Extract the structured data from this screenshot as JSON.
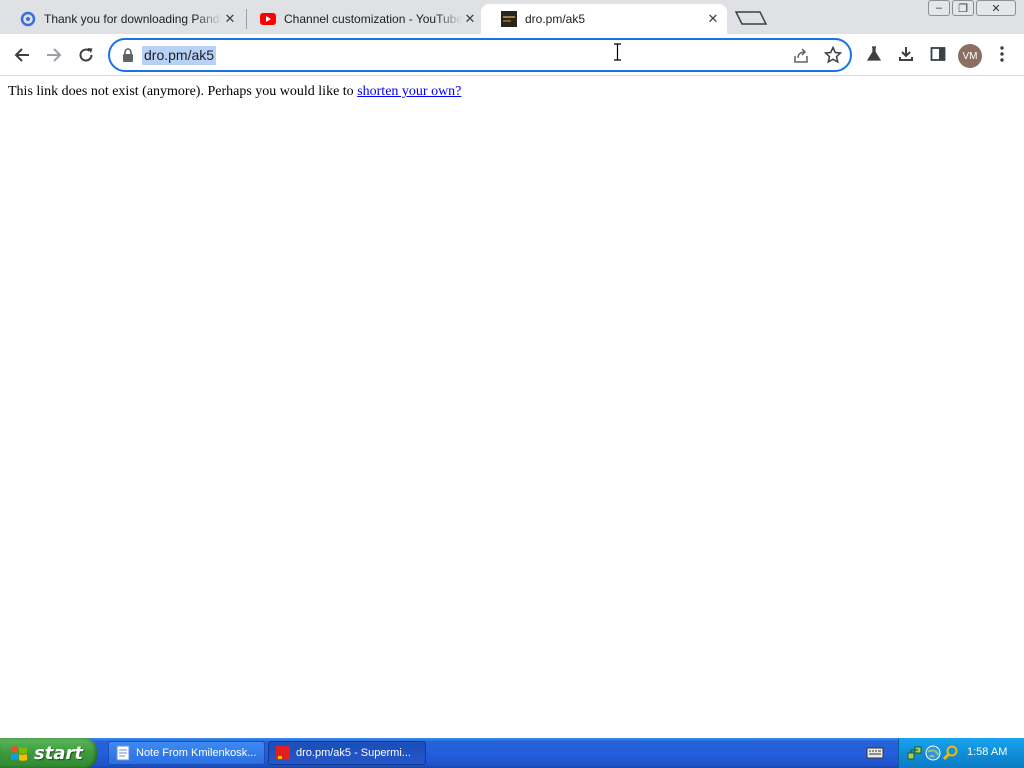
{
  "browser": {
    "tabs": [
      {
        "title": "Thank you for downloading Panda Security",
        "favicon": "panda-favicon",
        "active": false
      },
      {
        "title": "Channel customization - YouTube Studio",
        "favicon": "youtube-favicon",
        "active": false
      },
      {
        "title": "dro.pm/ak5",
        "favicon": "site-favicon",
        "active": true
      }
    ],
    "window_controls": {
      "minimize": "–",
      "restore": "❐",
      "close": "✕"
    },
    "toolbar": {
      "url": "dro.pm/ak5",
      "icons": [
        "back-icon",
        "forward-icon",
        "reload-icon",
        "lock-icon",
        "share-icon",
        "bookmark-star-icon",
        "labs-flask-icon",
        "download-icon",
        "side-panel-icon",
        "menu-kebab-icon"
      ],
      "profile_initials": "VM"
    }
  },
  "page": {
    "message_prefix": "This link does not exist (anymore). Perhaps you would like to ",
    "link_text": "shorten your own?"
  },
  "taskbar": {
    "start_label": "start",
    "items": [
      {
        "label": "Note From Kmilenkosk...",
        "icon": "notepad-icon",
        "pressed": false
      },
      {
        "label": "dro.pm/ak5 - Supermi...",
        "icon": "browser-icon",
        "pressed": true
      }
    ],
    "tray_icons": [
      "keyboard-icon",
      "network-icon",
      "globe-icon",
      "search-icon"
    ],
    "clock": "1:58 AM"
  }
}
